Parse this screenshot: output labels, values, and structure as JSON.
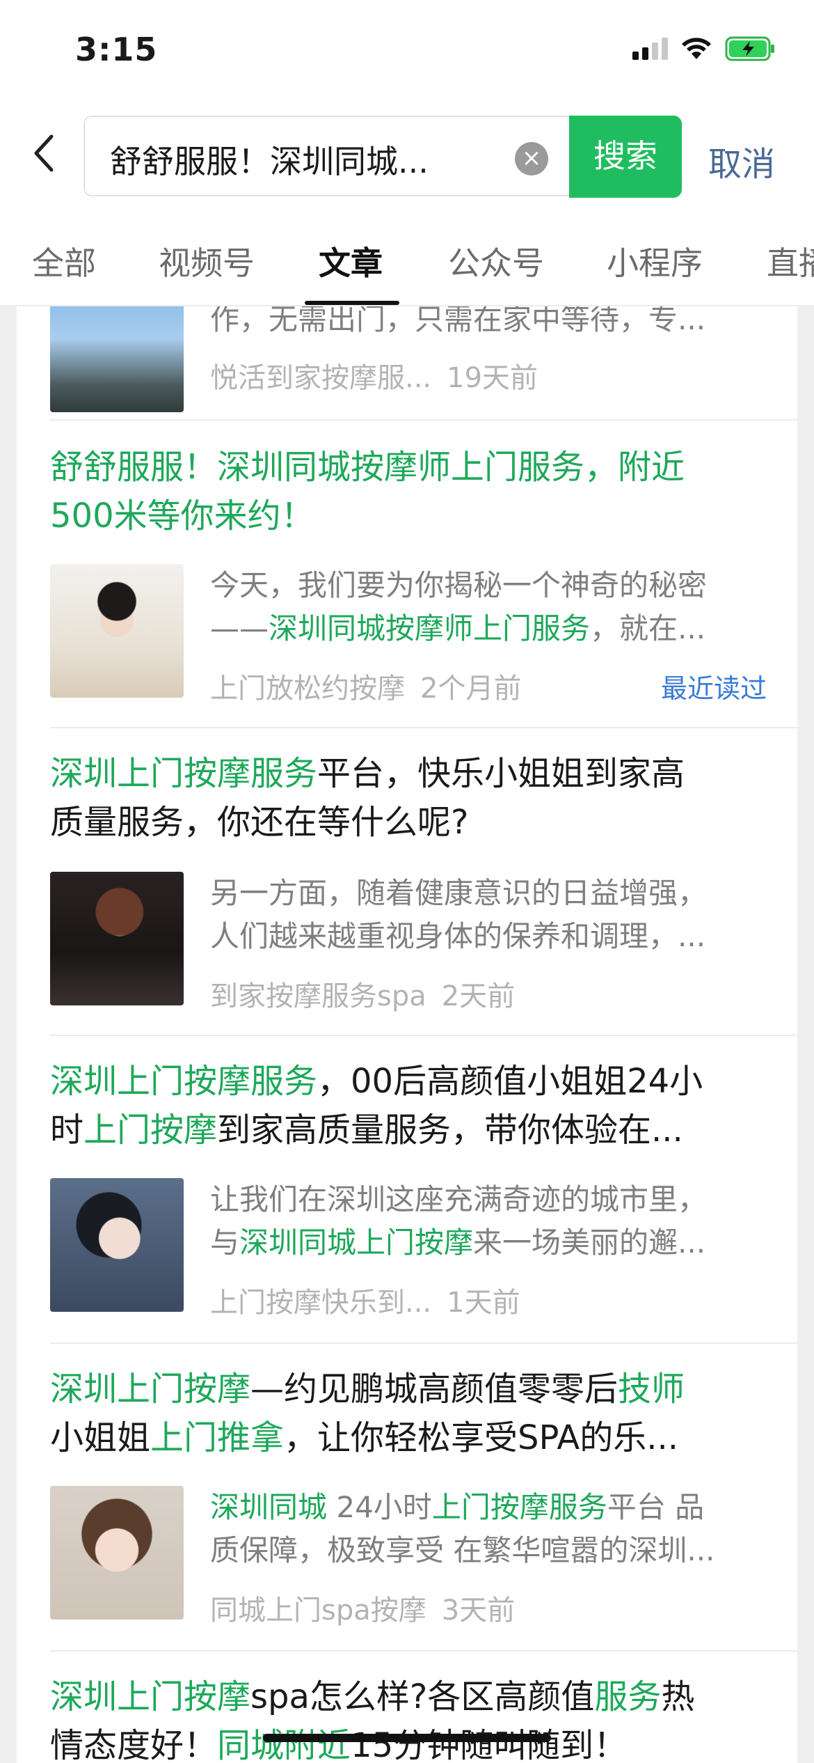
{
  "status": {
    "time": "3:15"
  },
  "search": {
    "query": "舒舒服服！深圳同城...",
    "search_button": "搜索",
    "cancel": "取消"
  },
  "tabs": [
    "全部",
    "视频号",
    "文章",
    "公众号",
    "小程序",
    "直播"
  ],
  "active_tab": "文章",
  "results": [
    {
      "snippet_lines": [
        "作，无需出门，只需在家中等待，专..."
      ],
      "source": "悦活到家按摩服...",
      "time": "19天前"
    },
    {
      "title_line1": [
        {
          "t": "舒舒服服！深圳同城按摩师上门服务，附近",
          "hl": true
        }
      ],
      "title_line2": [
        {
          "t": "500米等你来约！",
          "hl": true
        }
      ],
      "snippet_line1": [
        {
          "t": "今天，我们要为你揭秘一个神奇的秘密",
          "hl": false
        }
      ],
      "snippet_line2": [
        {
          "t": "——",
          "hl": false
        },
        {
          "t": "深圳同城按摩师上门服务",
          "hl": true
        },
        {
          "t": "，就在...",
          "hl": false
        }
      ],
      "source": "上门放松约按摩",
      "time": "2个月前",
      "badge": "最近读过"
    },
    {
      "title_line1": [
        {
          "t": "深圳上门按摩服务",
          "hl": true
        },
        {
          "t": "平台，快乐小姐姐到家高",
          "hl": false
        }
      ],
      "title_line2": [
        {
          "t": "质量服务，你还在等什么呢?",
          "hl": false
        }
      ],
      "snippet_line1": [
        {
          "t": "另一方面，随着健康意识的日益增强，",
          "hl": false
        }
      ],
      "snippet_line2": [
        {
          "t": "人们越来越重视身体的保养和调理，...",
          "hl": false
        }
      ],
      "source": "到家按摩服务spa",
      "time": "2天前"
    },
    {
      "title_line1": [
        {
          "t": "深圳上门按摩服务",
          "hl": true
        },
        {
          "t": "，00后高颜值小姐姐24小",
          "hl": false
        }
      ],
      "title_line2": [
        {
          "t": "时",
          "hl": false
        },
        {
          "t": "上门按摩",
          "hl": true
        },
        {
          "t": "到家高质量服务，带你体验在...",
          "hl": false
        }
      ],
      "snippet_line1": [
        {
          "t": "让我们在深圳这座充满奇迹的城市里，",
          "hl": false
        }
      ],
      "snippet_line2": [
        {
          "t": "与",
          "hl": false
        },
        {
          "t": "深圳同城上门按摩",
          "hl": true
        },
        {
          "t": "来一场美丽的邂...",
          "hl": false
        }
      ],
      "source": "上门按摩快乐到...",
      "time": "1天前"
    },
    {
      "title_line1": [
        {
          "t": "深圳上门按摩",
          "hl": true
        },
        {
          "t": "—约见鹏城高颜值零零后",
          "hl": false
        },
        {
          "t": "技师",
          "hl": true
        }
      ],
      "title_line2": [
        {
          "t": "小姐姐",
          "hl": false
        },
        {
          "t": "上门推拿",
          "hl": true
        },
        {
          "t": "，让你轻松享受SPA的乐...",
          "hl": false
        }
      ],
      "snippet_line1": [
        {
          "t": "深圳同城",
          "hl": true
        },
        {
          "t": " 24小时",
          "hl": false
        },
        {
          "t": "上门按摩服务",
          "hl": true
        },
        {
          "t": "平台 品",
          "hl": false
        }
      ],
      "snippet_line2": [
        {
          "t": "质保障，极致享受 在繁华喧嚣的深圳...",
          "hl": false
        }
      ],
      "source": "同城上门spa按摩",
      "time": "3天前"
    },
    {
      "title_line1": [
        {
          "t": "深圳上门按摩",
          "hl": true
        },
        {
          "t": "spa怎么样?各区高颜值",
          "hl": false
        },
        {
          "t": "服务",
          "hl": true
        },
        {
          "t": "热",
          "hl": false
        }
      ],
      "title_line2": [
        {
          "t": "情态度好！",
          "hl": false
        },
        {
          "t": "同城附近",
          "hl": true
        },
        {
          "t": "15分钟随叫随到！",
          "hl": false
        }
      ]
    }
  ]
}
